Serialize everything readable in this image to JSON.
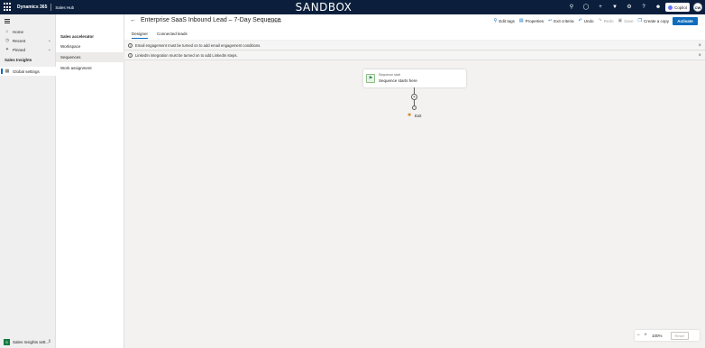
{
  "topbar": {
    "app_name": "Dynamics 365",
    "hub_name": "Sales Hub",
    "environment": "SANDBOX",
    "copilot_label": "Copilot",
    "avatar_initials": "CW",
    "icons": [
      "search-icon",
      "lightbulb-icon",
      "plus-icon",
      "filter-icon",
      "gear-icon",
      "help-icon",
      "people-icon"
    ]
  },
  "leftnav": {
    "items": [
      {
        "label": "Home",
        "icon": "home-icon"
      },
      {
        "label": "Recent",
        "icon": "clock-icon"
      },
      {
        "label": "Pinned",
        "icon": "pin-icon"
      }
    ],
    "section_title": "Sales Insights",
    "active_item": "Global settings",
    "bottom_area": "Sales Insights sett..."
  },
  "subnav": {
    "title": "Sales accelerator",
    "items": [
      "Workspace",
      "Sequences",
      "Work assignment"
    ],
    "active": "Sequences"
  },
  "header": {
    "title": "Enterprise SaaS Inbound Lead – 7-Day Sequence",
    "status": "- Inactive",
    "toolbar": {
      "edit_tags": "Edit tags",
      "properties": "Properties",
      "exit_criteria": "Exit criteria",
      "undo": "Undo",
      "redo": "Redo",
      "save": "Save",
      "create_copy": "Create a copy",
      "activate": "Activate"
    },
    "tabs": [
      "Designer",
      "Connected leads"
    ],
    "active_tab": "Designer"
  },
  "banners": [
    "Email engagement must be turned on to add email engagement conditions.",
    "LinkedIn integration must be turned on to add LinkedIn steps."
  ],
  "designer": {
    "start_label": "Sequence start",
    "start_text": "Sequence starts here",
    "exit_label": "Exit"
  },
  "zoom": {
    "value": "100%",
    "reset_label": "Reset"
  },
  "colors": {
    "topbar": "#0b1f3d",
    "accent": "#0f6cbd"
  }
}
